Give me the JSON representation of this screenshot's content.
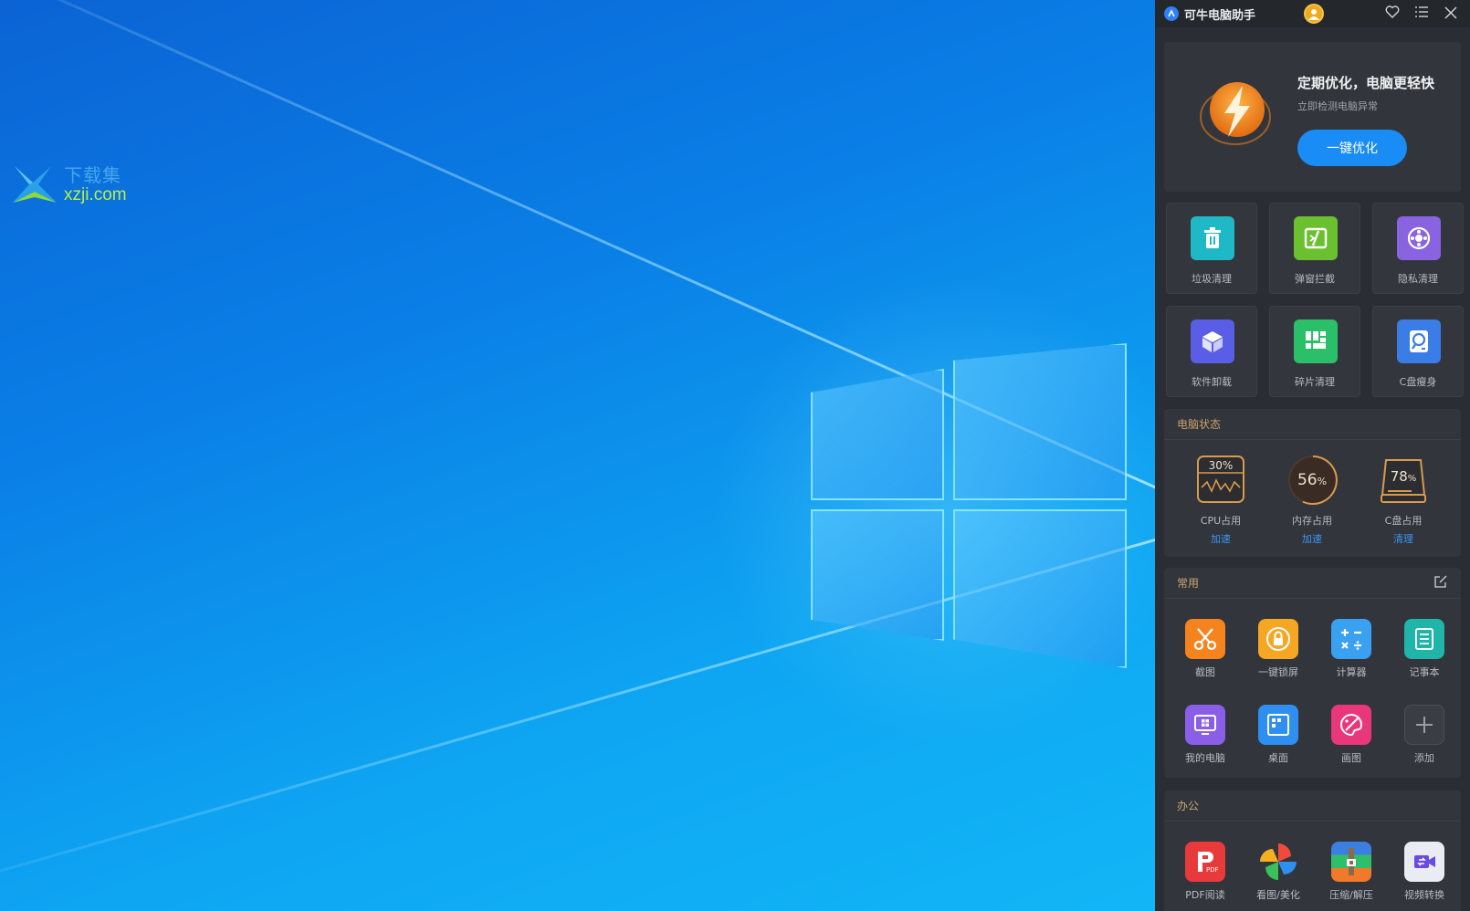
{
  "watermark": {
    "cn": "下载集",
    "url": "xzji.com"
  },
  "panel": {
    "title": "可牛电脑助手",
    "hero": {
      "title": "定期优化，电脑更轻快",
      "subtitle": "立即检测电脑异常",
      "button": "一键优化"
    },
    "tools": [
      {
        "label": "垃圾清理",
        "icon": "trash-icon",
        "color": "#1fb8c7"
      },
      {
        "label": "弹窗拦截",
        "icon": "popup-block-icon",
        "color": "#6ac02e"
      },
      {
        "label": "隐私清理",
        "icon": "privacy-icon",
        "color": "#8a63e0"
      },
      {
        "label": "软件卸载",
        "icon": "box-icon",
        "color": "#5a5ee6"
      },
      {
        "label": "碎片清理",
        "icon": "fragment-icon",
        "color": "#2cbf6a"
      },
      {
        "label": "C盘瘦身",
        "icon": "disk-icon",
        "color": "#3a7de6"
      }
    ],
    "status": {
      "title": "电脑状态",
      "items": [
        {
          "value": "30%",
          "label": "CPU占用",
          "action": "加速"
        },
        {
          "value": "56",
          "unit": "%",
          "label": "内存占用",
          "action": "加速"
        },
        {
          "value": "78",
          "unit": "%",
          "label": "C盘占用",
          "action": "清理"
        }
      ]
    },
    "common": {
      "title": "常用",
      "apps": [
        {
          "label": "截图",
          "icon": "scissors-icon",
          "color": "#f5841f"
        },
        {
          "label": "一键锁屏",
          "icon": "lock-icon",
          "color": "#f5a623"
        },
        {
          "label": "计算器",
          "icon": "calculator-icon",
          "color": "#3aa0f0"
        },
        {
          "label": "记事本",
          "icon": "notepad-icon",
          "color": "#1fb5a8"
        },
        {
          "label": "我的电脑",
          "icon": "computer-icon",
          "color": "#8a5ee6"
        },
        {
          "label": "桌面",
          "icon": "desktop-icon",
          "color": "#2f8ff0"
        },
        {
          "label": "画图",
          "icon": "paint-icon",
          "color": "#e8377a"
        },
        {
          "label": "添加",
          "icon": "plus-icon",
          "color": "#3a3d43"
        }
      ]
    },
    "office": {
      "title": "办公",
      "apps": [
        {
          "label": "PDF阅读",
          "icon": "pdf-icon",
          "color": "#e83a3a"
        },
        {
          "label": "看图/美化",
          "icon": "pinwheel-icon",
          "color": "#32353b"
        },
        {
          "label": "压缩/解压",
          "icon": "archive-icon",
          "color": "#3c7fe0"
        },
        {
          "label": "视频转换",
          "icon": "video-convert-icon",
          "color": "#e9ecf2"
        }
      ]
    }
  }
}
